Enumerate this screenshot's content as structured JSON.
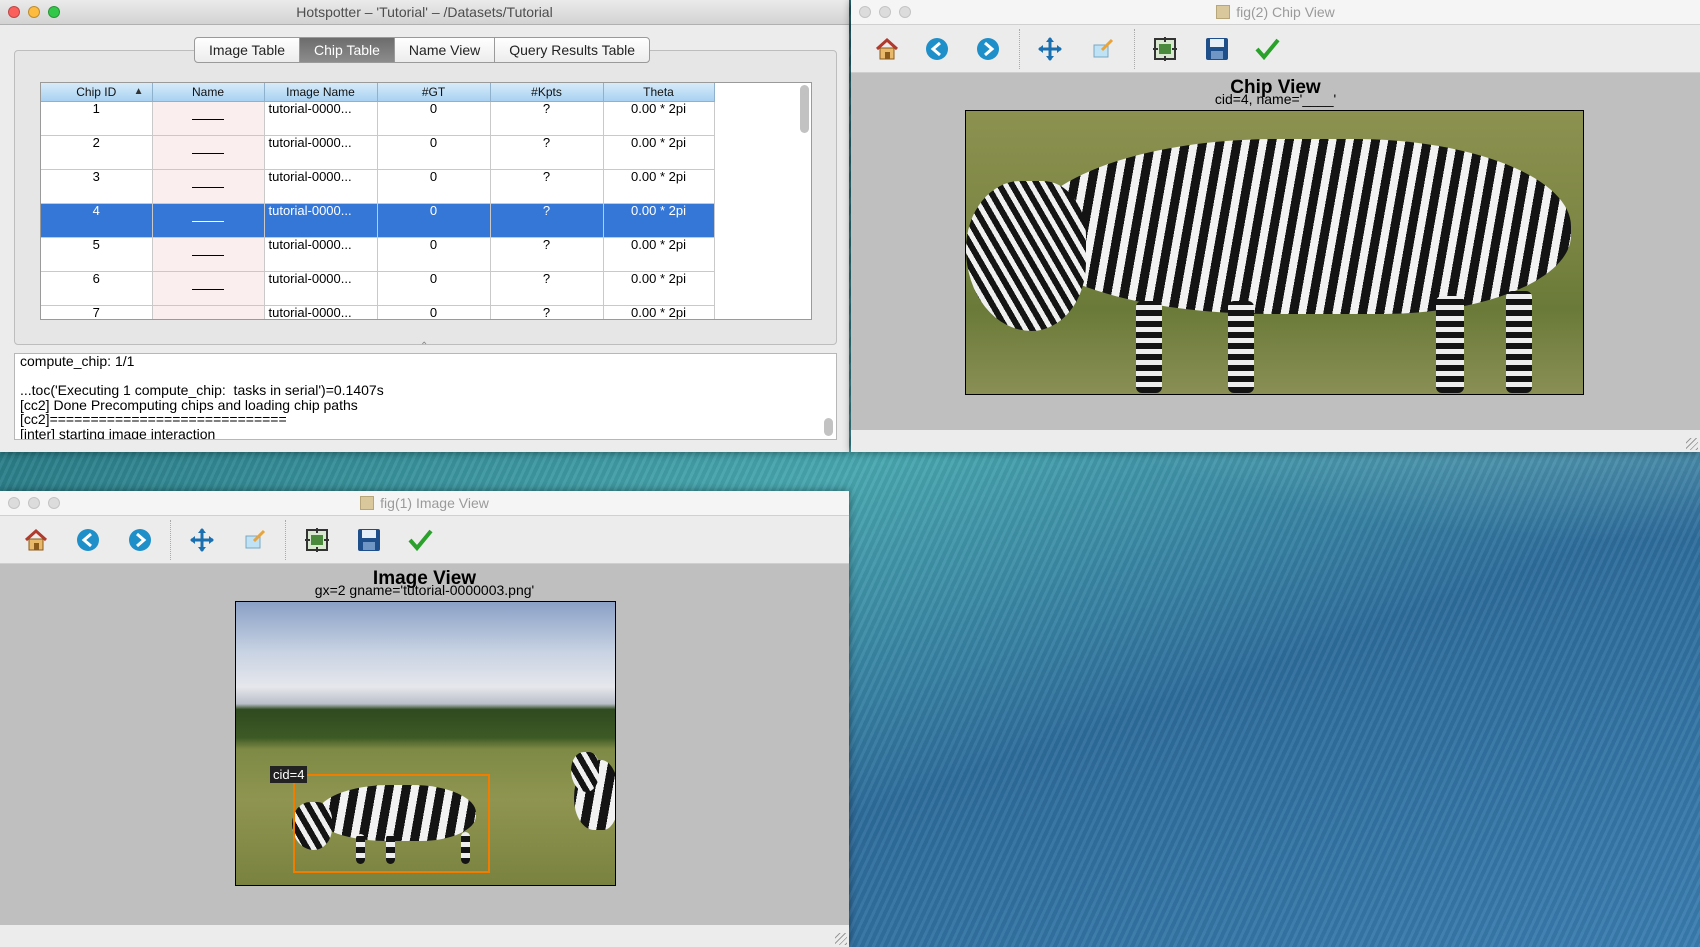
{
  "main_window": {
    "title": "Hotspotter – 'Tutorial' – /Datasets/Tutorial",
    "tabs": [
      {
        "label": "Image Table",
        "active": false
      },
      {
        "label": "Chip Table",
        "active": true
      },
      {
        "label": "Name View",
        "active": false
      },
      {
        "label": "Query Results Table",
        "active": false
      }
    ],
    "table": {
      "columns": [
        "Chip ID",
        "Name",
        "Image Name",
        "#GT",
        "#Kpts",
        "Theta"
      ],
      "sort_indicator": "▲",
      "rows": [
        {
          "chip_id": "1",
          "name": "____",
          "image_name": "tutorial-0000...",
          "gt": "0",
          "kpts": "?",
          "theta": "0.00 * 2pi"
        },
        {
          "chip_id": "2",
          "name": "____",
          "image_name": "tutorial-0000...",
          "gt": "0",
          "kpts": "?",
          "theta": "0.00 * 2pi"
        },
        {
          "chip_id": "3",
          "name": "____",
          "image_name": "tutorial-0000...",
          "gt": "0",
          "kpts": "?",
          "theta": "0.00 * 2pi"
        },
        {
          "chip_id": "4",
          "name": "____",
          "image_name": "tutorial-0000...",
          "gt": "0",
          "kpts": "?",
          "theta": "0.00 * 2pi"
        },
        {
          "chip_id": "5",
          "name": "____",
          "image_name": "tutorial-0000...",
          "gt": "0",
          "kpts": "?",
          "theta": "0.00 * 2pi"
        },
        {
          "chip_id": "6",
          "name": "____",
          "image_name": "tutorial-0000...",
          "gt": "0",
          "kpts": "?",
          "theta": "0.00 * 2pi"
        },
        {
          "chip_id": "7",
          "name": "____",
          "image_name": "tutorial-0000...",
          "gt": "0",
          "kpts": "?",
          "theta": "0.00 * 2pi"
        }
      ],
      "selected_chip_id": "4"
    },
    "log_lines": [
      "compute_chip: 1/1",
      "",
      "...toc('Executing 1 compute_chip:  tasks in serial')=0.1407s",
      "[cc2] Done Precomputing chips and loading chip paths",
      "[cc2]=============================",
      "[inter] starting image interaction"
    ]
  },
  "chip_window": {
    "title": "fig(2) Chip View",
    "figure_title": "Chip View",
    "figure_subtitle": "cid=4, name='____'"
  },
  "image_window": {
    "title": "fig(1) Image View",
    "figure_title": "Image View",
    "figure_subtitle": "gx=2 gname='tutorial-0000003.png'",
    "annotation_label": "cid=4"
  },
  "toolbar_icons": [
    "home-icon",
    "back-icon",
    "forward-icon",
    "pan-icon",
    "zoom-icon",
    "configure-subplots-icon",
    "save-icon",
    "check-icon"
  ],
  "colors": {
    "selection": "#3577d6",
    "annotation_box": "#f07d00",
    "header_blue": "#a8d2f2"
  }
}
